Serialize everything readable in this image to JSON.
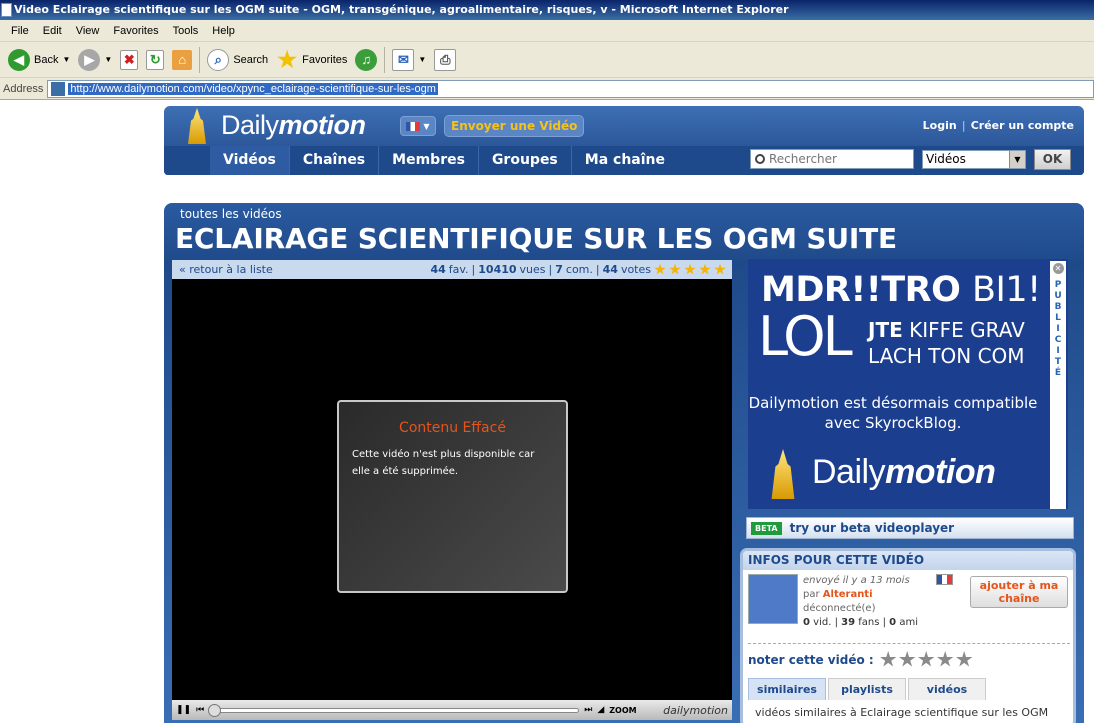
{
  "window": {
    "title": "Video Eclairage scientifique sur les OGM suite - OGM, transgénique, agroalimentaire, risques, v - Microsoft Internet Explorer"
  },
  "menubar": [
    "File",
    "Edit",
    "View",
    "Favorites",
    "Tools",
    "Help"
  ],
  "toolbar": {
    "back_label": "Back",
    "search_label": "Search",
    "favorites_label": "Favorites"
  },
  "addressbar": {
    "label": "Address",
    "url": "http://www.dailymotion.com/video/xpync_eclairage-scientifique-sur-les-ogm"
  },
  "header": {
    "logo_plain": "Daily",
    "logo_italic": "motion",
    "upload_label": "Envoyer une Vidéo",
    "login_label": "Login",
    "separator": "|",
    "register_label": "Créer un compte",
    "nav": [
      "Vidéos",
      "Chaînes",
      "Membres",
      "Groupes",
      "Ma chaîne"
    ],
    "search_placeholder": "Rechercher",
    "search_scope": "Vidéos",
    "ok_label": "OK"
  },
  "page": {
    "breadcrumb": "toutes les vidéos",
    "title": "ECLAIRAGE SCIENTIFIQUE SUR LES OGM SUITE"
  },
  "player": {
    "back_link": "« retour à la liste",
    "fav_count": "44",
    "fav_label": "fav.",
    "views_count": "10410",
    "views_label": "vues",
    "com_count": "7",
    "com_label": "com.",
    "votes_count": "44",
    "votes_label": "votes",
    "rating": 5,
    "deleted_title": "Contenu Effacé",
    "deleted_message": "Cette vidéo n'est plus disponible car elle a été supprimée.",
    "zoom_label": "ZOOM",
    "brand_label": "dailymotion"
  },
  "ad": {
    "line1_bold": "MDR!!TRO",
    "line1_regular": "BI1!",
    "lol": "LOL",
    "jte_bold": "JTE",
    "jte_regular": "KIFFE GRAV",
    "line3": "LACH TON COM",
    "sub": "Dailymotion est désormais compatible avec SkyrockBlog.",
    "logo_plain": "Daily",
    "logo_italic": "motion",
    "pub_label": "PUBLICITÉ"
  },
  "beta": {
    "tag": "BETA",
    "text": "try our beta videoplayer"
  },
  "info": {
    "header": "INFOS POUR CETTE VIDÉO",
    "sent": "envoyé il y a 13 mois",
    "by": "par",
    "user": "Alteranti",
    "status": "déconnecté(e)",
    "vid_count": "0",
    "vid_label": "vid.",
    "fans_count": "39",
    "fans_label": "fans",
    "friends_count": "0",
    "friends_label": "ami",
    "add_chain": "ajouter à ma chaîne",
    "rate_label": "noter cette vidéo :",
    "tabs": [
      "similaires",
      "playlists",
      "vidéos"
    ],
    "similar_text": "vidéos similaires à Eclairage scientifique sur les OGM"
  }
}
